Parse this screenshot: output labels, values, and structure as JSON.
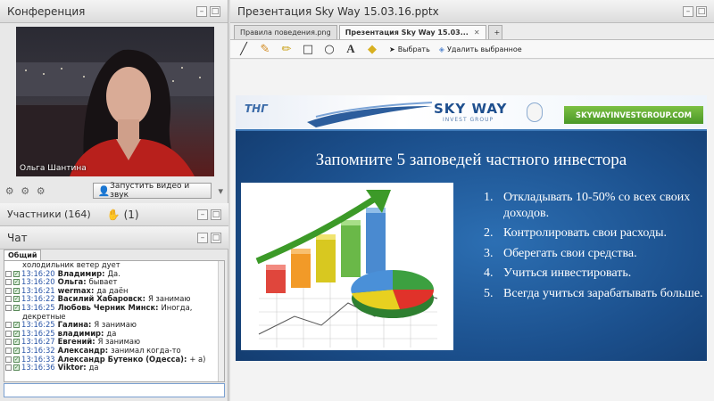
{
  "conference": {
    "title": "Конференция",
    "presenter_name": "Ольга Шантина",
    "start_video_label": "Запустить видео и звук"
  },
  "participants": {
    "label": "Участники (164)",
    "raised_hands": "(1)"
  },
  "chat": {
    "title": "Чат",
    "tab_label": "Общий",
    "partial_top": "холодильник ветер дует",
    "messages": [
      {
        "time": "13:16:20",
        "author": "Владимир:",
        "text": "Да."
      },
      {
        "time": "13:16:20",
        "author": "Ольга:",
        "text": "бывает"
      },
      {
        "time": "13:16:21",
        "author": "wermax:",
        "text": "да даён"
      },
      {
        "time": "13:16:22",
        "author": "Василий Хабаровск:",
        "text": "Я занимаю"
      },
      {
        "time": "13:16:25",
        "author": "Любовь Черник Минск:",
        "text": "Иногда,",
        "wrap": "декретные"
      },
      {
        "time": "13:16:25",
        "author": "Галина:",
        "text": "Я занимаю"
      },
      {
        "time": "13:16:25",
        "author": "владимир:",
        "text": "да"
      },
      {
        "time": "13:16:27",
        "author": "Евгений:",
        "text": "Я занимаю"
      },
      {
        "time": "13:16:32",
        "author": "Александр:",
        "text": "занимал когда-то"
      },
      {
        "time": "13:16:33",
        "author": "Александр Бутенко (Одесса):",
        "text": "+ а)"
      },
      {
        "time": "13:16:36",
        "author": "Viktor:",
        "text": "да"
      }
    ]
  },
  "presentation": {
    "title": "Презентация Sky Way 15.03.16.pptx",
    "tabs": [
      {
        "label": "Правила поведения.png"
      },
      {
        "label": "Презентация Sky Way 15.03..."
      }
    ],
    "tools": {
      "select_label": "Выбрать",
      "delete_label": "Удалить выбранное"
    },
    "slide": {
      "logo_tng": "ТНГ",
      "logo_skyway": "SKY WAY",
      "logo_sub": "INVEST GROUP",
      "site": "SKYWAYINVESTGROUP.COM",
      "heading": "Запомните 5 заповедей частного инвестора",
      "items": [
        {
          "num": "1.",
          "text": "Откладывать 10-50% со всех своих доходов."
        },
        {
          "num": "2.",
          "text": "Контролировать свои расходы."
        },
        {
          "num": "3.",
          "text": "Оберегать свои средства."
        },
        {
          "num": "4.",
          "text": "Учиться инвестировать."
        },
        {
          "num": "5.",
          "text": "Всегда учиться зарабатывать больше."
        }
      ]
    }
  },
  "colors": {
    "slide_bg": "#1b4f8c",
    "site_badge": "#5aa832",
    "chat_time": "#2a56a8"
  }
}
